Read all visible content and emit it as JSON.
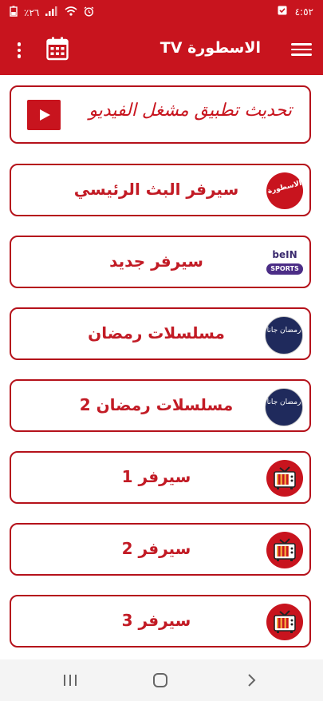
{
  "status_bar": {
    "time": "٤:٥٢",
    "battery": "٪٢٦",
    "icons": [
      "battery-icon",
      "signal-icon",
      "wifi-icon",
      "alarm-icon",
      "notification-icon"
    ]
  },
  "app_bar": {
    "title": "الاسطورة TV",
    "icons": [
      "menu-icon",
      "calendar-icon",
      "more-vert-icon"
    ]
  },
  "update_banner": {
    "label": "تحديث تطبيق مشغل الفيديو",
    "icon": "play-icon"
  },
  "items": [
    {
      "label": "سيرفر البث الرئيسي",
      "icon": "brand-logo-icon",
      "icon_text": "الاسطورة"
    },
    {
      "label": "سيرفر جديد",
      "icon": "bein-sports-logo-icon",
      "icon_text_top": "beIN",
      "icon_text_bottom": "SPORTS"
    },
    {
      "label": "مسلسلات رمضان",
      "icon": "ramadan-logo-icon",
      "icon_text": "رمضان جانا"
    },
    {
      "label": "مسلسلات رمضان 2",
      "icon": "ramadan-logo-icon",
      "icon_text": "رمضان جانا"
    },
    {
      "label": "سيرفر 1",
      "icon": "tv-icon"
    },
    {
      "label": "سيرفر 2",
      "icon": "tv-icon"
    },
    {
      "label": "سيرفر 3",
      "icon": "tv-icon"
    }
  ],
  "nav_bar": {
    "icons": [
      "recent-apps-icon",
      "home-icon",
      "back-icon"
    ]
  },
  "colors": {
    "primary": "#c8141e",
    "text_red": "#c21b25",
    "border": "#b5121b"
  }
}
